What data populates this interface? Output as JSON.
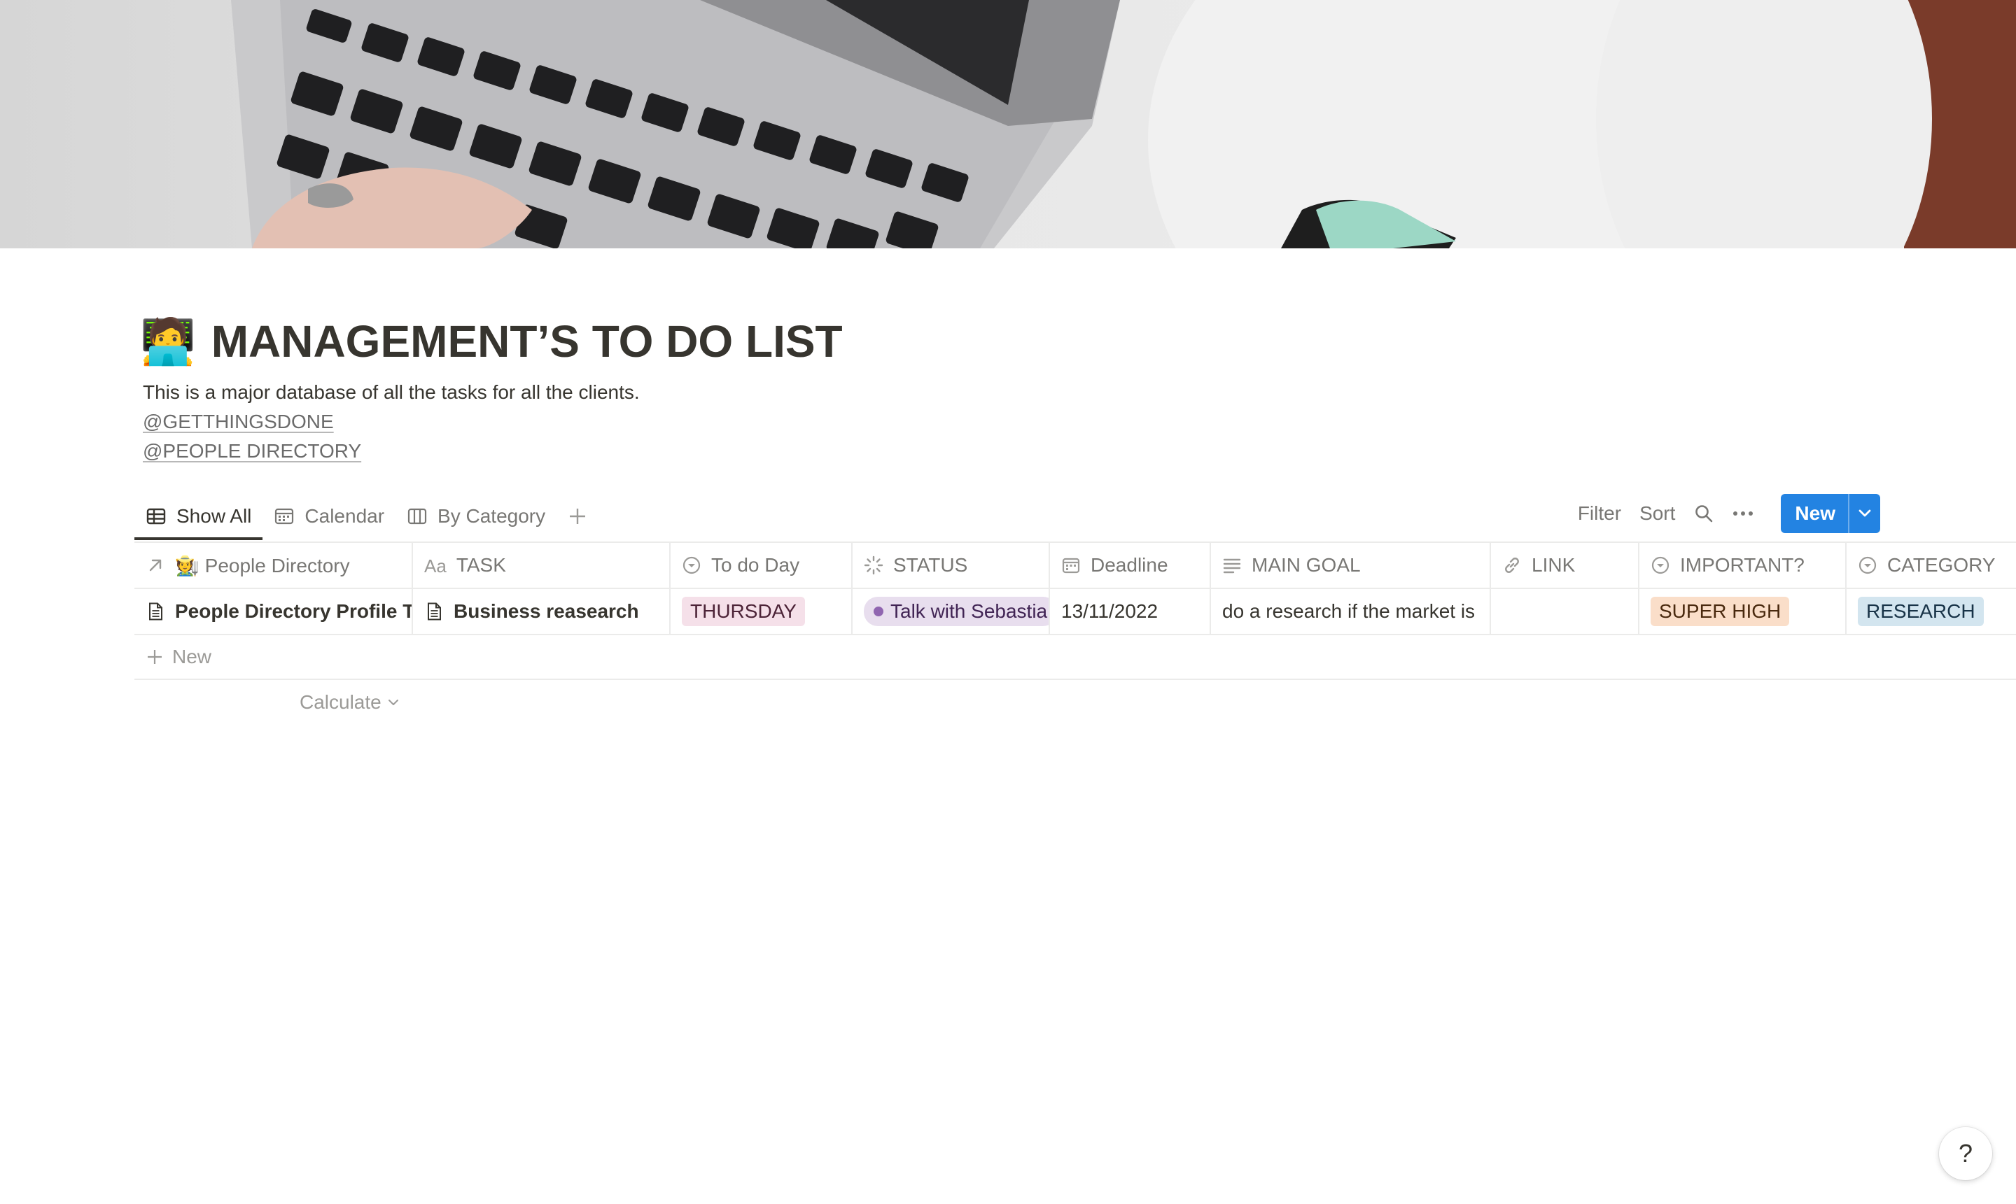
{
  "page": {
    "emoji": "🧑‍💻",
    "title": "MANAGEMENT’S TO DO LIST",
    "description": "This is a major database of all the tasks for all the clients.",
    "mentions": [
      "@GETTHINGSDONE",
      "@PEOPLE DIRECTORY"
    ]
  },
  "views": {
    "tabs": [
      {
        "label": "Show All",
        "icon": "table-icon",
        "active": true
      },
      {
        "label": "Calendar",
        "icon": "calendar-icon",
        "active": false
      },
      {
        "label": "By Category",
        "icon": "board-icon",
        "active": false
      }
    ]
  },
  "toolbar": {
    "filter": "Filter",
    "sort": "Sort",
    "new": "New"
  },
  "table": {
    "columns": [
      {
        "label": "🧑‍🌾 People Directory",
        "icon": "relation-arrow-icon"
      },
      {
        "label": "TASK",
        "icon": "title-aa-icon"
      },
      {
        "label": "To do Day",
        "icon": "select-icon"
      },
      {
        "label": "STATUS",
        "icon": "status-icon"
      },
      {
        "label": "Deadline",
        "icon": "date-icon"
      },
      {
        "label": "MAIN GOAL",
        "icon": "text-icon"
      },
      {
        "label": "LINK",
        "icon": "link-icon"
      },
      {
        "label": "IMPORTANT?",
        "icon": "select-icon"
      },
      {
        "label": "CATEGORY",
        "icon": "select-icon"
      }
    ],
    "rows": [
      {
        "people": "People Directory Profile T",
        "task": "Business reasearch",
        "todo_day": "THURSDAY",
        "status": "Talk with Sebastia",
        "deadline": "13/11/2022",
        "main_goal": "do a research if the market is",
        "link": "",
        "important": "SUPER HIGH",
        "category": "RESEARCH"
      }
    ],
    "new_row_label": "New",
    "calculate_label": "Calculate"
  },
  "help": {
    "label": "?"
  },
  "colors": {
    "accent": "#2383e2",
    "text": "#37352f",
    "muted": "#787774"
  }
}
